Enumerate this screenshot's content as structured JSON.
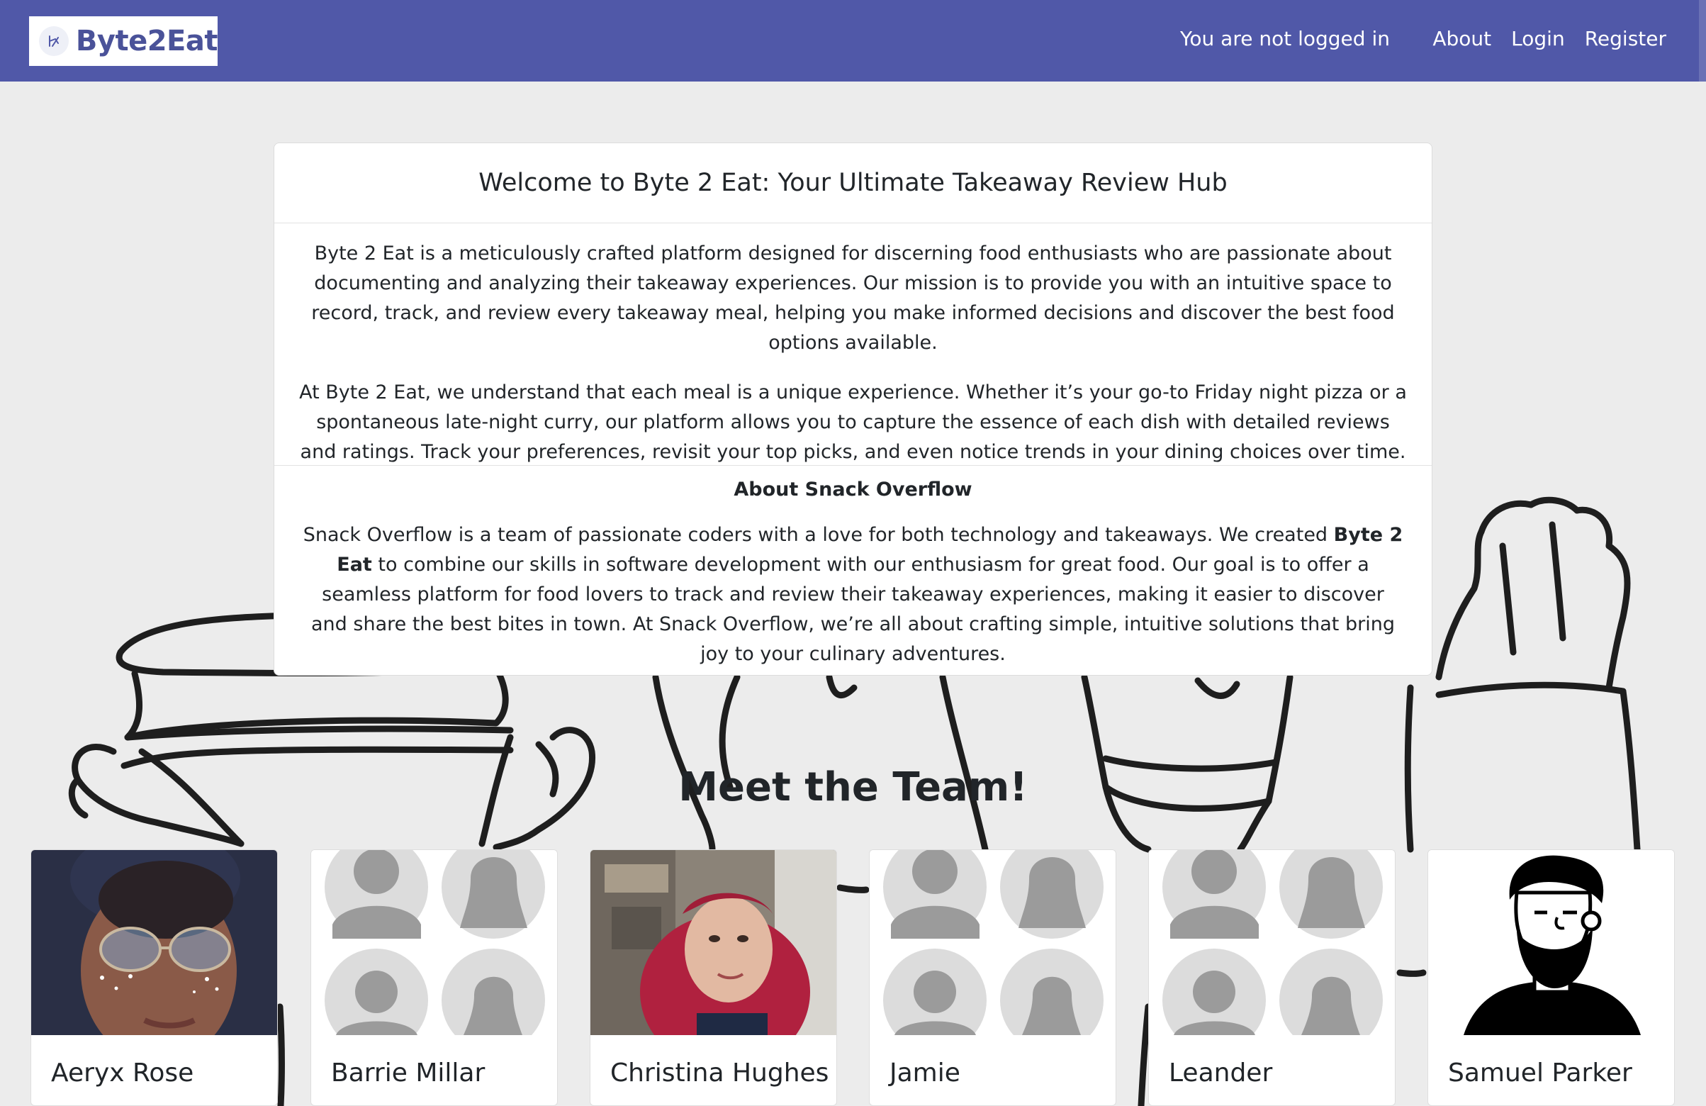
{
  "navbar": {
    "brand": "Byte2Eat",
    "status": "You are not logged in",
    "links": [
      "About",
      "Login",
      "Register"
    ]
  },
  "welcome": {
    "title": "Welcome to Byte 2 Eat: Your Ultimate Takeaway Review Hub",
    "paragraph1": "Byte 2 Eat is a meticulously crafted platform designed for discerning food enthusiasts who are passionate about documenting and analyzing their takeaway experiences. Our mission is to provide you with an intuitive space to record, track, and review every takeaway meal, helping you make informed decisions and discover the best food options available.",
    "paragraph2": "At Byte 2 Eat, we understand that each meal is a unique experience. Whether it’s your go-to Friday night pizza or a spontaneous late-night curry, our platform allows you to capture the essence of each dish with detailed reviews and ratings. Track your preferences, revisit your top picks, and even notice trends in your dining choices over time."
  },
  "about": {
    "title": "About Snack Overflow",
    "text_before": "Snack Overflow is a team of passionate coders with a love for both technology and takeaways. We created ",
    "text_strong": "Byte 2 Eat",
    "text_after": " to combine our skills in software development with our enthusiasm for great food. Our goal is to offer a seamless platform for food lovers to track and review their takeaway experiences, making it easier to discover and share the best bites in town. At Snack Overflow, we’re all about crafting simple, intuitive solutions that bring joy to your culinary adventures."
  },
  "team": {
    "title": "Meet the Team!",
    "members": [
      {
        "name": "Aeryx Rose",
        "photo": "portrait-photo"
      },
      {
        "name": "Barrie Millar",
        "photo": "placeholder-avatars"
      },
      {
        "name": "Christina Hughes",
        "photo": "portrait-photo"
      },
      {
        "name": "Jamie",
        "photo": "placeholder-avatars"
      },
      {
        "name": "Leander",
        "photo": "placeholder-avatars"
      },
      {
        "name": "Samuel Parker",
        "photo": "cartoon-avatar"
      }
    ]
  },
  "colors": {
    "navbar": "#5058a8",
    "brand_text": "#4a5299",
    "background": "#ececec",
    "card": "#ffffff"
  }
}
